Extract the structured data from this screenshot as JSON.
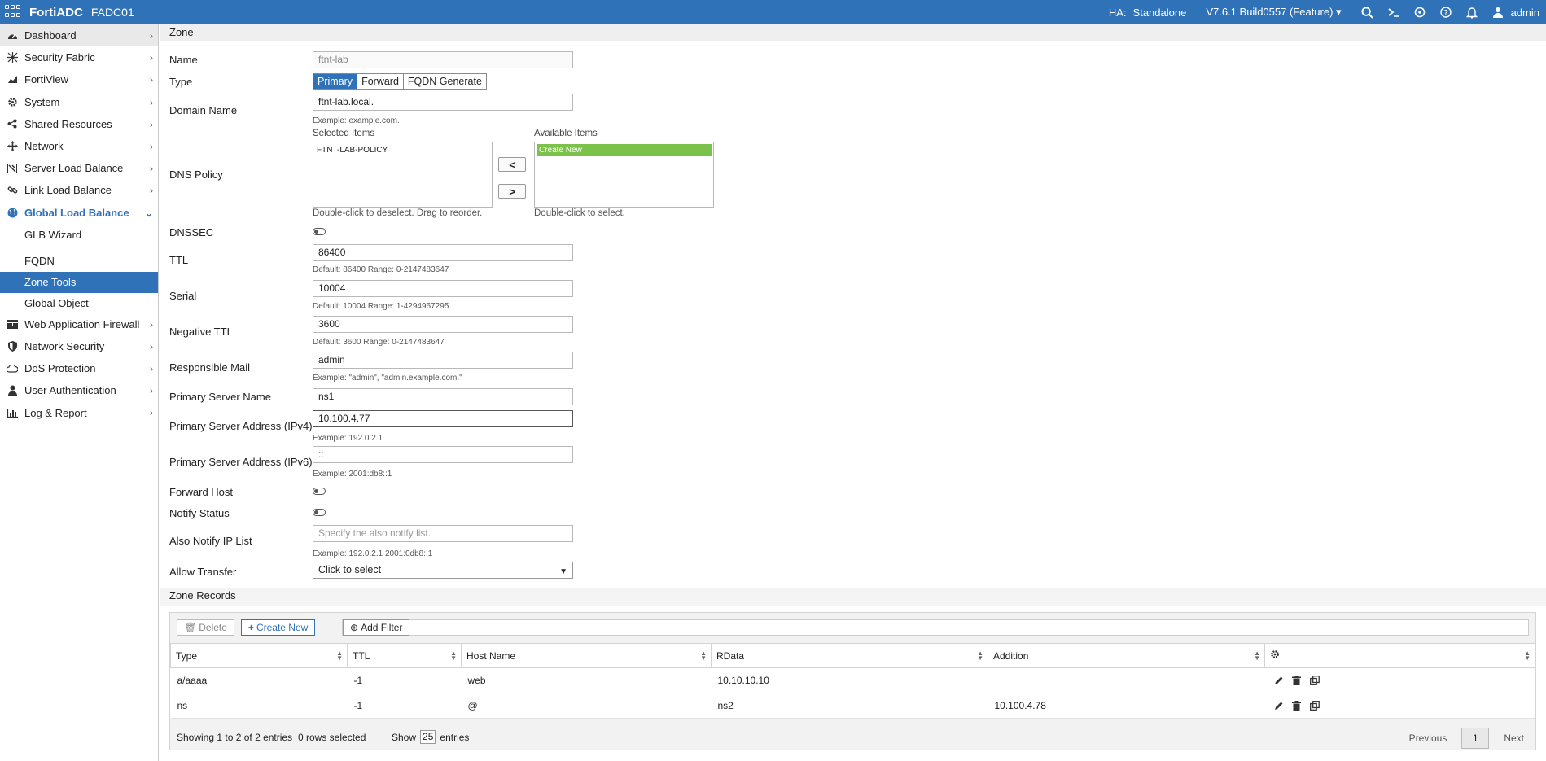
{
  "topbar": {
    "brand": "FortiADC",
    "hostname": "FADC01",
    "ha_label": "HA:",
    "ha_value": "Standalone",
    "version": "V7.6.1 Build0557 (Feature)",
    "user": "admin"
  },
  "sidebar": {
    "items": [
      {
        "label": "Dashboard",
        "icon": "dashboard-icon"
      },
      {
        "label": "Security Fabric",
        "icon": "fabric-icon"
      },
      {
        "label": "FortiView",
        "icon": "chart-icon"
      },
      {
        "label": "System",
        "icon": "gear-icon"
      },
      {
        "label": "Shared Resources",
        "icon": "share-icon"
      },
      {
        "label": "Network",
        "icon": "network-icon"
      },
      {
        "label": "Server Load Balance",
        "icon": "server-icon"
      },
      {
        "label": "Link Load Balance",
        "icon": "link-icon"
      },
      {
        "label": "Global Load Balance",
        "icon": "globe-icon"
      },
      {
        "label": "Web Application Firewall",
        "icon": "waf-icon"
      },
      {
        "label": "Network Security",
        "icon": "shield-icon"
      },
      {
        "label": "DoS Protection",
        "icon": "cloud-icon"
      },
      {
        "label": "User Authentication",
        "icon": "user-icon"
      },
      {
        "label": "Log & Report",
        "icon": "report-icon"
      }
    ],
    "glb_sub": [
      "GLB Wizard",
      "FQDN",
      "Zone Tools",
      "Global Object"
    ]
  },
  "form": {
    "section_title": "Zone",
    "name_label": "Name",
    "name_value": "ftnt-lab",
    "type_label": "Type",
    "type_options": [
      "Primary",
      "Forward",
      "FQDN Generate"
    ],
    "domain_label": "Domain Name",
    "domain_value": "ftnt-lab.local.",
    "domain_hint": "Example: example.com.",
    "dns_policy_label": "DNS Policy",
    "selected_items_label": "Selected Items",
    "available_items_label": "Available Items",
    "selected_items": [
      "FTNT-LAB-POLICY"
    ],
    "available_items": [
      "Create New"
    ],
    "selected_hint": "Double-click to deselect. Drag to reorder.",
    "available_hint": "Double-click to select.",
    "dnssec_label": "DNSSEC",
    "ttl_label": "TTL",
    "ttl_value": "86400",
    "ttl_hint": "Default: 86400 Range: 0-2147483647",
    "serial_label": "Serial",
    "serial_value": "10004",
    "serial_hint": "Default: 10004 Range: 1-4294967295",
    "neg_ttl_label": "Negative TTL",
    "neg_ttl_value": "3600",
    "neg_ttl_hint": "Default: 3600 Range: 0-2147483647",
    "resp_mail_label": "Responsible Mail",
    "resp_mail_value": "admin",
    "resp_mail_hint": "Example: \"admin\", \"admin.example.com.\"",
    "primary_name_label": "Primary Server Name",
    "primary_name_value": "ns1",
    "primary_ipv4_label": "Primary Server Address (IPv4)",
    "primary_ipv4_value": "10.100.4.77",
    "primary_ipv4_hint": "Example: 192.0.2.1",
    "primary_ipv6_label": "Primary Server Address (IPv6)",
    "primary_ipv6_value": "::",
    "primary_ipv6_hint": "Example: 2001:db8::1",
    "forward_host_label": "Forward Host",
    "notify_status_label": "Notify Status",
    "also_notify_label": "Also Notify IP List",
    "also_notify_placeholder": "Specify the also notify list.",
    "also_notify_hint": "Example: 192.0.2.1 2001:0db8::1",
    "allow_transfer_label": "Allow Transfer",
    "allow_transfer_value": "Click to select"
  },
  "zone_records": {
    "title": "Zone Records",
    "delete_label": "Delete",
    "create_label": "Create New",
    "filter_label": "Add Filter",
    "columns": [
      "Type",
      "TTL",
      "Host Name",
      "RData",
      "Addition"
    ],
    "rows": [
      {
        "type": "a/aaaa",
        "ttl": "-1",
        "host": "web",
        "rdata": "10.10.10.10",
        "addition": ""
      },
      {
        "type": "ns",
        "ttl": "-1",
        "host": "@",
        "rdata": "ns2",
        "addition": "10.100.4.78"
      }
    ],
    "footer_info": "Showing 1 to 2 of 2 entries",
    "rows_selected": "0 rows selected",
    "show_label": "Show",
    "show_value": "25",
    "entries_label": "entries",
    "prev_label": "Previous",
    "page": "1",
    "next_label": "Next"
  }
}
